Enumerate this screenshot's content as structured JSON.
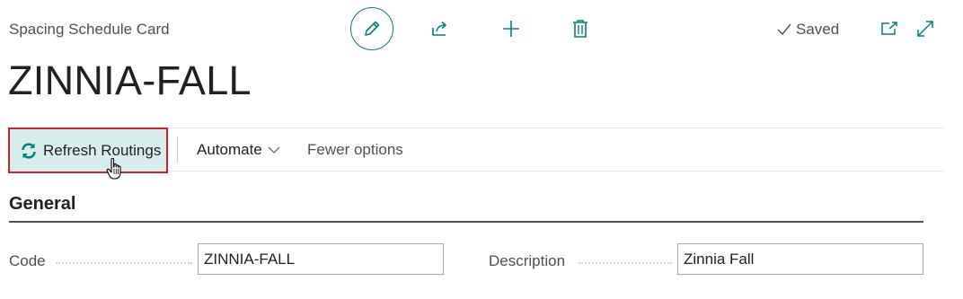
{
  "header": {
    "caption": "Spacing Schedule Card",
    "title": "ZINNIA-FALL",
    "saved_label": "Saved"
  },
  "actions": {
    "refresh_routings": "Refresh Routings",
    "automate": "Automate",
    "fewer_options": "Fewer options"
  },
  "sections": {
    "general": {
      "title": "General",
      "code_label": "Code",
      "code_value": "ZINNIA-FALL",
      "description_label": "Description",
      "description_value": "Zinnia Fall"
    }
  },
  "icons": {
    "edit": "pencil-icon",
    "share": "share-icon",
    "add": "plus-icon",
    "delete": "trash-icon",
    "popout": "open-new-window-icon",
    "expand": "expand-icon",
    "refresh": "refresh-icon",
    "saved": "checkmark-icon"
  },
  "colors": {
    "accent": "#00807f",
    "highlight_border": "#c0272d",
    "highlight_fill": "#d8edec"
  }
}
